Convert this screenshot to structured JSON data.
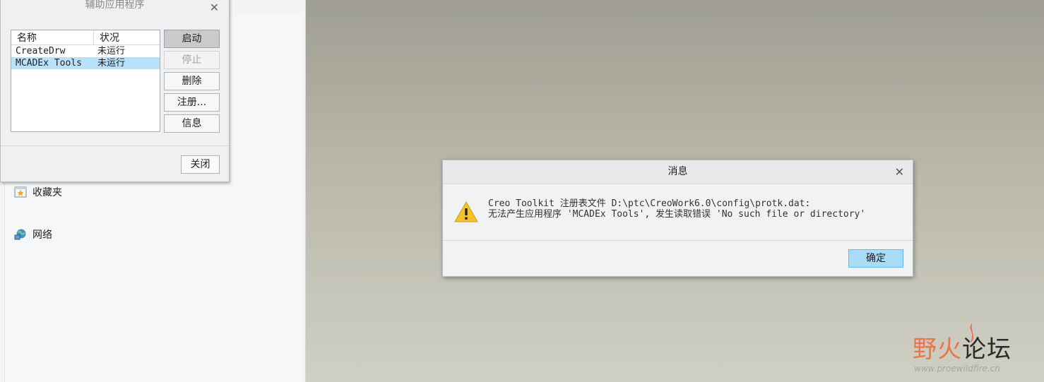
{
  "left_panel": {
    "items": [
      {
        "label": "收藏夹",
        "icon": "favorites-icon"
      },
      {
        "label": "网络",
        "icon": "network-icon"
      }
    ]
  },
  "aux_dialog": {
    "title": "辅助应用程序",
    "columns": [
      "名称",
      "状况"
    ],
    "rows": [
      {
        "name": "CreateDrw",
        "status": "未运行",
        "selected": false
      },
      {
        "name": "MCADEx Tools",
        "status": "未运行",
        "selected": true
      }
    ],
    "buttons": {
      "start": "启动",
      "stop": "停止",
      "delete": "删除",
      "register": "注册...",
      "info": "信息"
    },
    "close_label": "关闭"
  },
  "message_dialog": {
    "title": "消息",
    "line1": "Creo Toolkit 注册表文件 D:\\ptc\\CreoWork6.0\\config\\protk.dat:",
    "line2": "无法产生应用程序 'MCADEx Tools', 发生读取错误 'No such file or directory'",
    "ok_label": "确定"
  },
  "watermark": {
    "title_part1": "野火",
    "title_part2": "论坛",
    "url": "www.proewildfire.cn"
  },
  "colors": {
    "selection": "#b9e1fb",
    "ok_button": "#a9dcf7",
    "warning": "#f5c22a"
  }
}
